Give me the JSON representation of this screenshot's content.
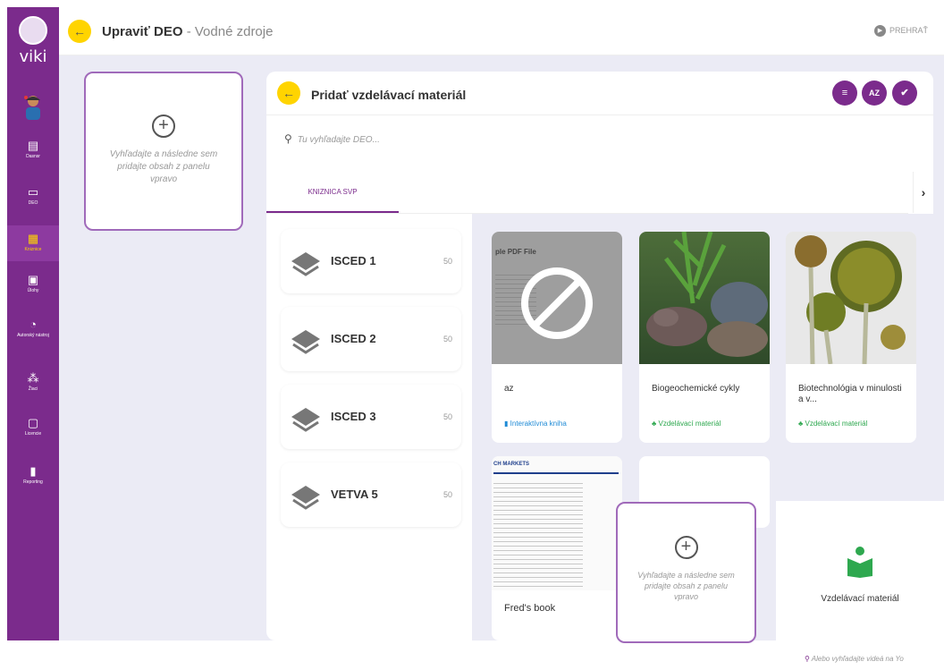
{
  "app": {
    "logo_text": "viki"
  },
  "sidebar": {
    "items": [
      {
        "icon": "dashboard-icon",
        "label": "Dasnsr"
      },
      {
        "icon": "deo-icon",
        "label": "DEO"
      },
      {
        "icon": "grid-icon",
        "label": "Kniznice",
        "active": true
      },
      {
        "icon": "task-icon",
        "label": "Úlohy"
      },
      {
        "icon": "author-icon",
        "label": "Autorský nástroj"
      },
      {
        "icon": "students-icon",
        "label": "Žiaci"
      },
      {
        "icon": "license-icon",
        "label": "Licencie"
      },
      {
        "icon": "chart-icon",
        "label": "Reporting"
      }
    ]
  },
  "header": {
    "title": "Upraviť DEO",
    "subtitle": "- Vodné zdroje",
    "play_label": "PREHRAŤ"
  },
  "dropzone": {
    "text": "Vyhľadajte a následne sem pridajte obsah z panelu vpravo"
  },
  "panel": {
    "title": "Pridať vzdelávací materiál",
    "search_placeholder": "Tu vyhľadajte DEO...",
    "tab": "KNIZNICA SVP",
    "buttons": [
      "filter-icon",
      "sort-az-icon",
      "check-all-icon"
    ]
  },
  "levels": [
    {
      "name": "ISCED 1",
      "count": "50"
    },
    {
      "name": "ISCED 2",
      "count": "50"
    },
    {
      "name": "ISCED 3",
      "count": "50"
    },
    {
      "name": "VETVA 5",
      "count": "50"
    }
  ],
  "cards": [
    {
      "title": "az",
      "category": "Interaktívna kniha",
      "thumb_text": "ple PDF File"
    },
    {
      "title": "Biogeochemické cykly",
      "category": "Vzdelávací materiál"
    },
    {
      "title": "Biotechnológia v minulosti a v...",
      "category": "Vzdelávací materiál"
    },
    {
      "title": "Fred's book",
      "thumb_text": "CH MARKETS"
    }
  ],
  "overlay": {
    "dropzone_text": "Vyhľadajte a následne sem pridajte obsah z panelu vpravo",
    "material_label": "Vzdelávací materiál",
    "youtube_search": "Alebo vyhľadajte videá na Yo"
  },
  "colors": {
    "purple": "#7b2b8c",
    "yellow": "#ffd400",
    "green": "#2ea84f",
    "blue": "#1f8bd6"
  }
}
